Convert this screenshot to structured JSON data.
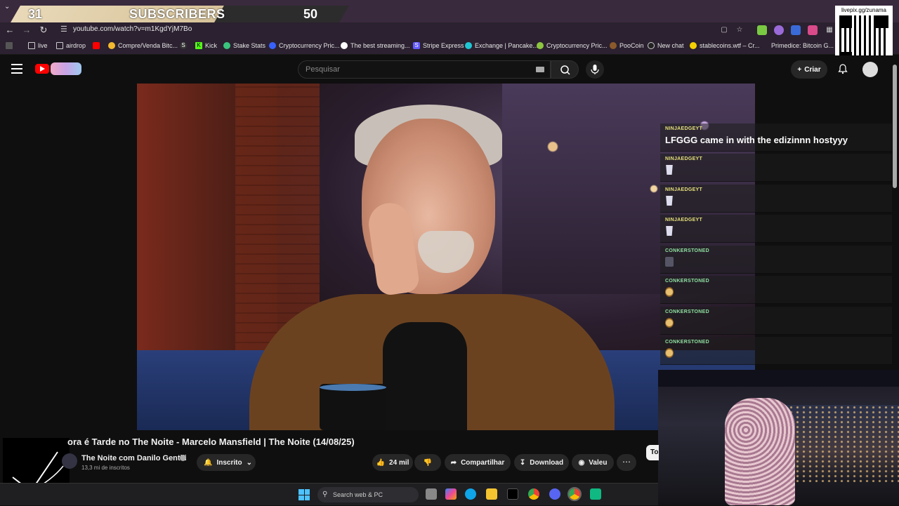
{
  "overlay": {
    "subs_current": "31",
    "subs_label": "SUBSCRIBERS",
    "subs_goal": "50"
  },
  "browser": {
    "url": "youtube.com/watch?v=m1KgdYjM7Bo",
    "bookmarks": [
      {
        "label": "live",
        "icon": "folder-icon"
      },
      {
        "label": "airdrop",
        "icon": "folder-icon"
      },
      {
        "label": "Compre/Venda Bitc...",
        "icon": "binance-icon"
      },
      {
        "label": "",
        "icon": "stake-icon"
      },
      {
        "label": "Kick",
        "icon": "kick-icon"
      },
      {
        "label": "Stake Stats",
        "icon": "stake-stats-icon"
      },
      {
        "label": "Cryptocurrency Pric...",
        "icon": "coinmarketcap-icon"
      },
      {
        "label": "The best streaming...",
        "icon": "streaming-icon"
      },
      {
        "label": "Stripe Express",
        "icon": "stripe-icon"
      },
      {
        "label": "Exchange | Pancake...",
        "icon": "pancake-icon"
      },
      {
        "label": "Cryptocurrency Pric...",
        "icon": "coingecko-icon"
      },
      {
        "label": "PooCoin",
        "icon": "poocoin-icon"
      },
      {
        "label": "New chat",
        "icon": "openai-icon"
      },
      {
        "label": "stablecoins.wtf – Cr...",
        "icon": "stablecoins-icon"
      },
      {
        "label": "Primedice: Bitcoin G...",
        "icon": "primedice-icon"
      }
    ]
  },
  "qr": {
    "caption": "livepix.gg/zunama"
  },
  "youtube": {
    "search_placeholder": "Pesquisar",
    "create_label": "Criar"
  },
  "chat": [
    {
      "user": "NINJAEDGEYT",
      "message": "LFGGG came in with the edizinnn hostyyy",
      "emote": null,
      "color": "#e6e07a"
    },
    {
      "user": "NINJAEDGEYT",
      "message": "",
      "emote": "cup-emote",
      "color": "#e6e07a"
    },
    {
      "user": "NINJAEDGEYT",
      "message": "",
      "emote": "cup-emote",
      "color": "#e6e07a"
    },
    {
      "user": "NINJAEDGEYT",
      "message": "",
      "emote": "cup-emote",
      "color": "#e6e07a"
    },
    {
      "user": "CONKERSTONED",
      "message": "",
      "emote": "avatar-emote",
      "color": "#8fe0a0"
    },
    {
      "user": "CONKERSTONED",
      "message": "",
      "emote": "face-emote",
      "color": "#8fe0a0"
    },
    {
      "user": "CONKERSTONED",
      "message": "",
      "emote": "face-emote",
      "color": "#8fe0a0"
    },
    {
      "user": "CONKERSTONED",
      "message": "",
      "emote": "face-emote",
      "color": "#8fe0a0"
    }
  ],
  "video": {
    "title": "ora é Tarde no The Noite - Marcelo Mansfield | The Noite (14/08/25)",
    "channel_name": "The Noite com Danilo Gentili",
    "subscribers": "13,3 mi de inscritos",
    "subscribed_label": "Inscrito",
    "likes": "24 mil",
    "share_label": "Compartilhar",
    "download_label": "Download",
    "thanks_label": "Valeu",
    "to_label": "To"
  },
  "taskbar": {
    "search_placeholder": "Search web & PC"
  }
}
